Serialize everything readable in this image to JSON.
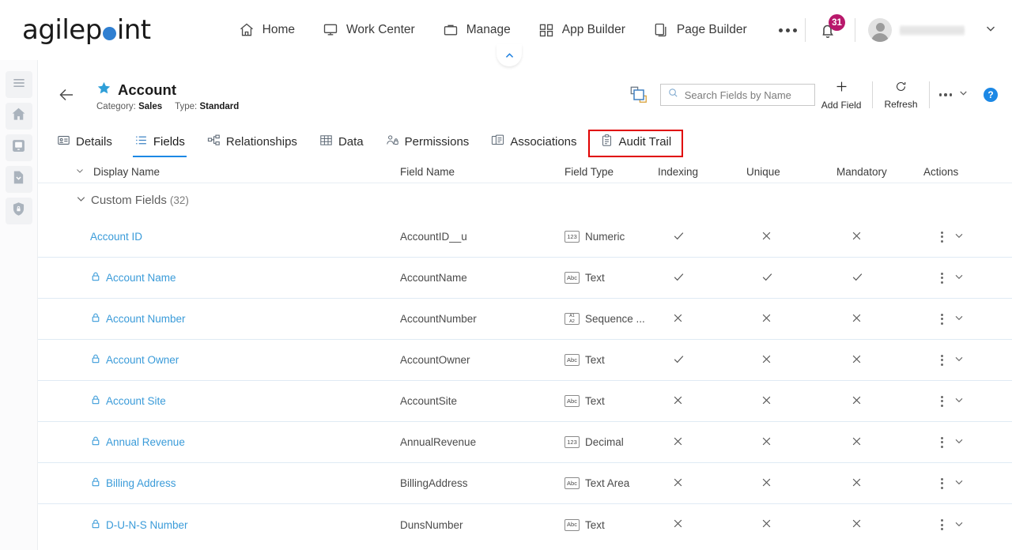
{
  "header": {
    "logo_text_1": "agilep",
    "logo_text_2": "int",
    "nav": [
      {
        "label": "Home",
        "icon": "home-icon"
      },
      {
        "label": "Work Center",
        "icon": "monitor-icon"
      },
      {
        "label": "Manage",
        "icon": "briefcase-icon"
      },
      {
        "label": "App Builder",
        "icon": "grid-icon"
      },
      {
        "label": "Page Builder",
        "icon": "pages-icon"
      }
    ],
    "more_icon": "ellipsis-icon",
    "notification_count": "31",
    "username": "",
    "account_chevron": "chevron-down-icon",
    "collapse_toggle": "chevron-up-icon"
  },
  "sidebar": {
    "items": [
      {
        "icon": "hamburger-menu-icon",
        "name": "menu"
      },
      {
        "icon": "home-icon",
        "name": "home"
      },
      {
        "icon": "monitor-icon",
        "name": "screen"
      },
      {
        "icon": "document-download-icon",
        "name": "documents"
      },
      {
        "icon": "shield-lock-icon",
        "name": "security"
      }
    ]
  },
  "page": {
    "back_icon": "back-arrow-icon",
    "star_icon": "star-icon",
    "title": "Account",
    "category_label": "Category:",
    "category_value": "Sales",
    "type_label": "Type:",
    "type_value": "Standard"
  },
  "toolbar": {
    "copy_icon": "layers-copy-icon",
    "search_placeholder": "Search Fields by Name",
    "search_value": "",
    "search_icon": "search-icon",
    "add_field_label": "Add Field",
    "add_field_icon": "plus-icon",
    "refresh_label": "Refresh",
    "refresh_icon": "refresh-icon",
    "overflow_icon": "ellipsis-icon",
    "overflow_chevron": "chevron-down-icon",
    "help_label": "?"
  },
  "tabs": [
    {
      "label": "Details",
      "icon": "details-icon",
      "active": false,
      "highlighted": false
    },
    {
      "label": "Fields",
      "icon": "list-icon",
      "active": true,
      "highlighted": false
    },
    {
      "label": "Relationships",
      "icon": "relationships-icon",
      "active": false,
      "highlighted": false
    },
    {
      "label": "Data",
      "icon": "table-icon",
      "active": false,
      "highlighted": false
    },
    {
      "label": "Permissions",
      "icon": "permissions-icon",
      "active": false,
      "highlighted": false
    },
    {
      "label": "Associations",
      "icon": "associations-icon",
      "active": false,
      "highlighted": false
    },
    {
      "label": "Audit Trail",
      "icon": "clipboard-icon",
      "active": false,
      "highlighted": true
    }
  ],
  "table": {
    "columns": {
      "display_name": "Display Name",
      "field_name": "Field Name",
      "field_type": "Field Type",
      "indexing": "Indexing",
      "unique": "Unique",
      "mandatory": "Mandatory",
      "actions": "Actions"
    },
    "group": {
      "label": "Custom Fields",
      "count": "(32)",
      "chevron": "chevron-down-icon"
    },
    "rows": [
      {
        "display_name": "Account ID",
        "locked": false,
        "field_name": "AccountID__u",
        "type_icon": "123",
        "field_type": "Numeric",
        "indexing": "check",
        "unique": "cross",
        "mandatory": "cross"
      },
      {
        "display_name": "Account Name",
        "locked": true,
        "field_name": "AccountName",
        "type_icon": "Abc",
        "field_type": "Text",
        "indexing": "check",
        "unique": "check",
        "mandatory": "check"
      },
      {
        "display_name": "Account Number",
        "locked": true,
        "field_name": "AccountNumber",
        "type_icon": "A1A2",
        "field_type": "Sequence ...",
        "indexing": "cross",
        "unique": "cross",
        "mandatory": "cross"
      },
      {
        "display_name": "Account Owner",
        "locked": true,
        "field_name": "AccountOwner",
        "type_icon": "Abc",
        "field_type": "Text",
        "indexing": "check",
        "unique": "cross",
        "mandatory": "cross"
      },
      {
        "display_name": "Account Site",
        "locked": true,
        "field_name": "AccountSite",
        "type_icon": "Abc",
        "field_type": "Text",
        "indexing": "cross",
        "unique": "cross",
        "mandatory": "cross"
      },
      {
        "display_name": "Annual Revenue",
        "locked": true,
        "field_name": "AnnualRevenue",
        "type_icon": "123",
        "field_type": "Decimal",
        "indexing": "cross",
        "unique": "cross",
        "mandatory": "cross"
      },
      {
        "display_name": "Billing Address",
        "locked": true,
        "field_name": "BillingAddress",
        "type_icon": "Abc",
        "field_type": "Text Area",
        "indexing": "cross",
        "unique": "cross",
        "mandatory": "cross"
      },
      {
        "display_name": "D-U-N-S Number",
        "locked": true,
        "field_name": "DunsNumber",
        "type_icon": "Abc",
        "field_type": "Text",
        "indexing": "cross",
        "unique": "cross",
        "mandatory": "cross"
      }
    ]
  },
  "colors": {
    "brand_blue": "#2f7fd1",
    "link_blue": "#3a9bd9",
    "accent_tab": "#1c88e5",
    "badge_magenta": "#b8186b",
    "highlight_red": "#e00000",
    "star_blue": "#2f9fd8"
  }
}
